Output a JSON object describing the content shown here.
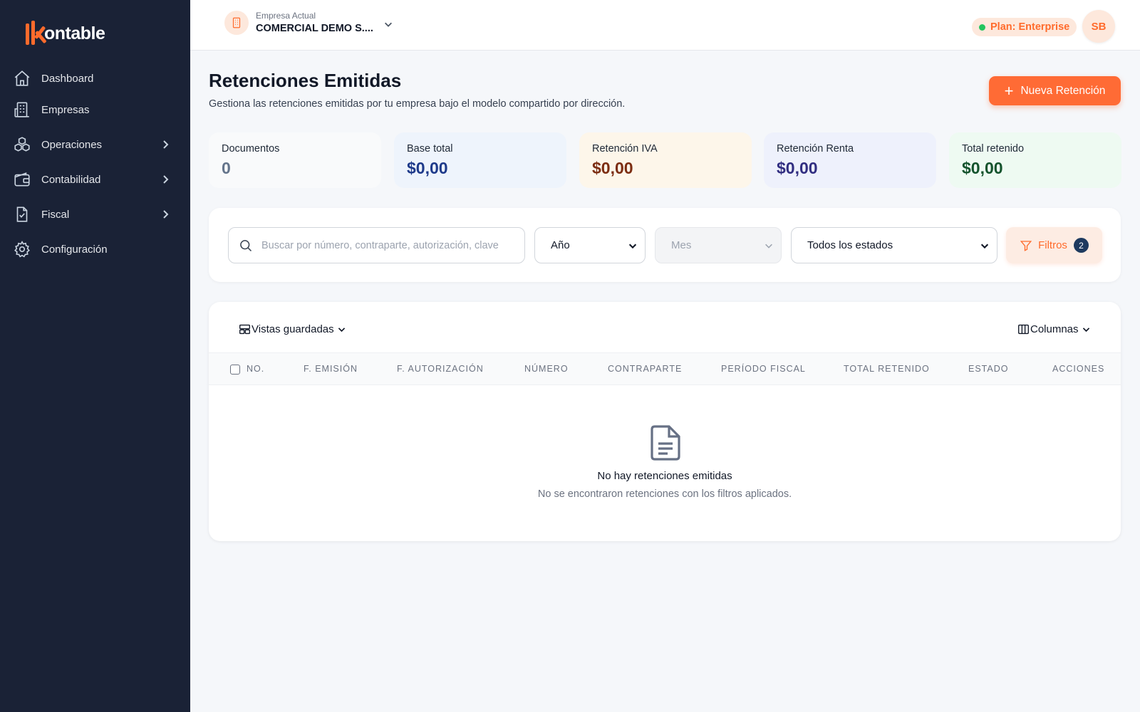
{
  "app": {
    "logo_text": "ontable"
  },
  "sidebar": {
    "items": [
      {
        "label": "Dashboard",
        "icon": "home-icon",
        "has_submenu": false
      },
      {
        "label": "Empresas",
        "icon": "building-icon",
        "has_submenu": false
      },
      {
        "label": "Operaciones",
        "icon": "cubes-icon",
        "has_submenu": true
      },
      {
        "label": "Contabilidad",
        "icon": "wallet-icon",
        "has_submenu": true
      },
      {
        "label": "Fiscal",
        "icon": "document-check-icon",
        "has_submenu": true
      },
      {
        "label": "Configuración",
        "icon": "gear-icon",
        "has_submenu": false
      }
    ]
  },
  "header": {
    "company_label": "Empresa Actual",
    "company_name": "COMERCIAL DEMO S....",
    "plan": "Plan: Enterprise",
    "avatar_initials": "SB"
  },
  "page": {
    "title": "Retenciones Emitidas",
    "subtitle": "Gestiona las retenciones emitidas por tu empresa bajo el modelo compartido por dirección.",
    "new_button": "Nueva Retención"
  },
  "stats": [
    {
      "label": "Documentos",
      "value": "0",
      "bg": "#f9fafb",
      "color": "#64748b"
    },
    {
      "label": "Base total",
      "value": "$0,00",
      "bg": "#eef4fc",
      "color": "#1e3a8a"
    },
    {
      "label": "Retención IVA",
      "value": "$0,00",
      "bg": "#fdf6ea",
      "color": "#7c2d12"
    },
    {
      "label": "Retención Renta",
      "value": "$0,00",
      "bg": "#eef1fc",
      "color": "#312e81"
    },
    {
      "label": "Total retenido",
      "value": "$0,00",
      "bg": "#eefaf2",
      "color": "#14532d"
    }
  ],
  "filters": {
    "search_placeholder": "Buscar por número, contraparte, autorización, clave",
    "year": "Año",
    "month": "Mes",
    "status": "Todos los estados",
    "filters_button": "Filtros",
    "filters_count": "2"
  },
  "table": {
    "saved_views": "Vistas guardadas",
    "columns_button": "Columnas",
    "headers": [
      "No.",
      "F. Emisión",
      "F. Autorización",
      "Número",
      "Contraparte",
      "Período Fiscal",
      "Total Retenido",
      "Estado",
      "Acciones"
    ],
    "empty_title": "No hay retenciones emitidas",
    "empty_subtitle": "No se encontraron retenciones con los filtros aplicados."
  },
  "colors": {
    "accent": "#ff6b35",
    "sidebar": "#1a2236"
  }
}
